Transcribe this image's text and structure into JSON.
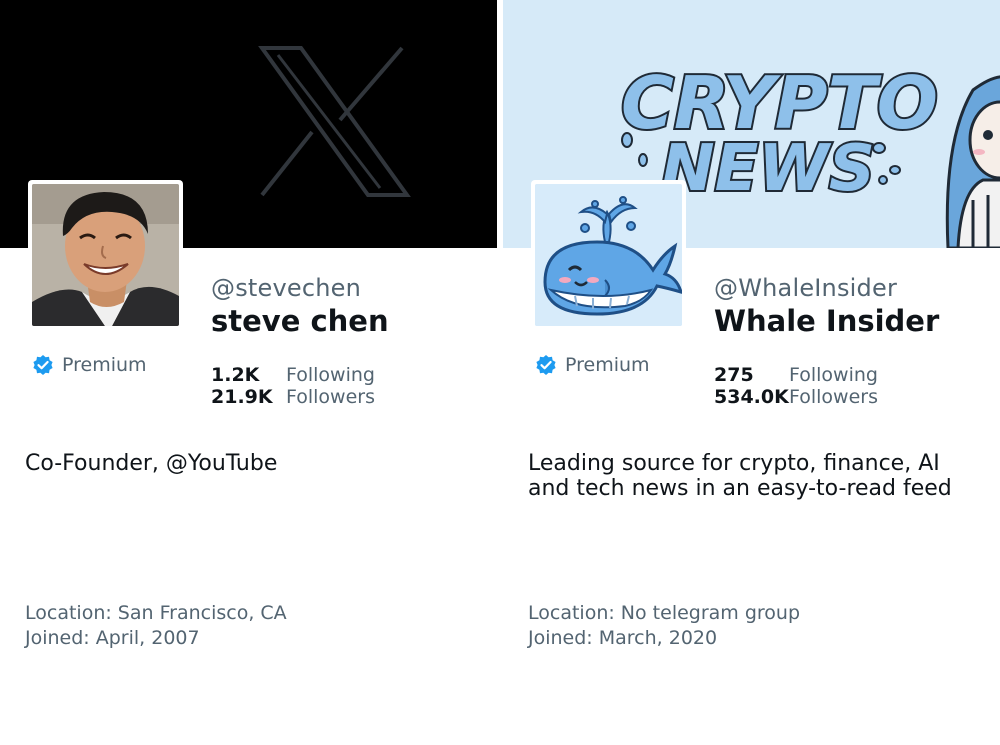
{
  "profiles": [
    {
      "banner": "x-logo-banner",
      "avatar": "person-photo",
      "handle": "@stevechen",
      "name": "steve chen",
      "premium_label": "Premium",
      "following_count": "1.2K",
      "following_label": "Following",
      "followers_count": "21.9K",
      "followers_label": "Followers",
      "bio": [
        "Co-Founder, @YouTube"
      ],
      "location": "Location: San Francisco, CA",
      "joined": "Joined: April, 2007"
    },
    {
      "banner": "crypto-news-banner",
      "banner_text": [
        "CRYPTO",
        "NEWS"
      ],
      "avatar": "whale-icon",
      "handle": "@WhaleInsider",
      "name": "Whale Insider",
      "premium_label": "Premium",
      "following_count": "275",
      "following_label": "Following",
      "followers_count": "534.0K",
      "followers_label": "Followers",
      "bio": [
        "Leading source for crypto, finance, AI",
        "and tech news in an easy-to-read feed"
      ],
      "location": "Location: No telegram group",
      "joined": "Joined: March, 2020"
    }
  ],
  "colors": {
    "verified_blue": "#1d9bf0",
    "muted_text": "#536471",
    "banner_left_bg": "#000000",
    "banner_right_bg": "#d6eaf8"
  }
}
